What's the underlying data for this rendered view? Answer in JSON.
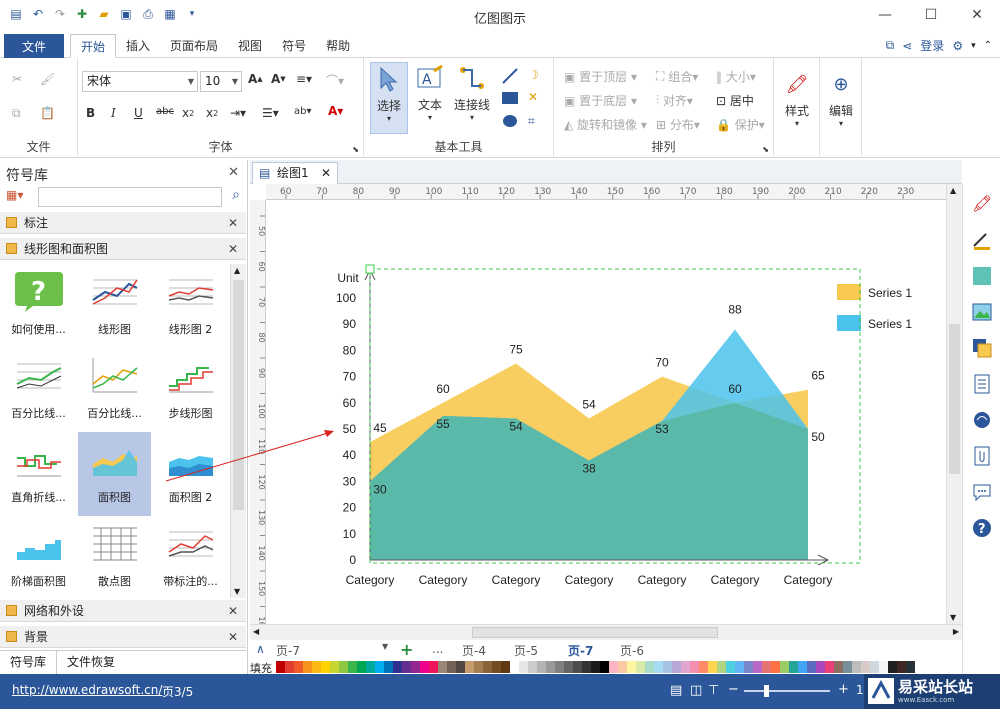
{
  "window": {
    "title": "亿图图示"
  },
  "menu": {
    "file": "文件",
    "tabs": [
      "开始",
      "插入",
      "页面布局",
      "视图",
      "符号",
      "帮助"
    ],
    "active_tab": "开始",
    "login": "登录"
  },
  "ribbon": {
    "font_name": "宋体",
    "font_size": "10",
    "groups": {
      "file": "文件",
      "font": "字体",
      "basic_tools": "基本工具",
      "arrange": "排列"
    },
    "tools": {
      "select": "选择",
      "text": "文本",
      "connector": "连接线",
      "style": "样式",
      "edit": "编辑"
    },
    "arrange": {
      "bring_front": "置于顶层",
      "send_back": "置于底层",
      "rotate_mirror": "旋转和镜像",
      "group": "组合",
      "align": "对齐",
      "distribute": "分布",
      "size": "大小",
      "center": "居中",
      "protect": "保护"
    }
  },
  "library": {
    "title": "符号库",
    "categories": {
      "annotation": "标注",
      "line_area": "线形图和面积图",
      "grid_outer": "网络和外设",
      "background": "背景"
    },
    "shapes": [
      {
        "label": "如何使用...",
        "kind": "help"
      },
      {
        "label": "线形图",
        "kind": "line"
      },
      {
        "label": "线形图 2",
        "kind": "line2"
      },
      {
        "label": "百分比线...",
        "kind": "pctline"
      },
      {
        "label": "百分比线...",
        "kind": "pctline2"
      },
      {
        "label": "步线形图",
        "kind": "step"
      },
      {
        "label": "直角折线...",
        "kind": "rightangle"
      },
      {
        "label": "面积图",
        "kind": "area",
        "selected": true
      },
      {
        "label": "面积图 2",
        "kind": "area2"
      },
      {
        "label": "阶梯面积图",
        "kind": "steparea"
      },
      {
        "label": "散点图",
        "kind": "scatter"
      },
      {
        "label": "带标注的...",
        "kind": "annotated"
      }
    ],
    "bottom_tabs": [
      "符号库",
      "文件恢复"
    ]
  },
  "document": {
    "tab": "绘图1",
    "hruler": [
      "60",
      "70",
      "80",
      "90",
      "100",
      "110",
      "120",
      "130",
      "140",
      "150",
      "160",
      "170",
      "180",
      "190",
      "200",
      "210",
      "220",
      "230"
    ],
    "vruler": [
      "50",
      "60",
      "70",
      "80",
      "90",
      "100",
      "110",
      "120",
      "130",
      "140",
      "150",
      "160"
    ],
    "pages": [
      "页-7",
      "...",
      "页-4",
      "页-5",
      "页-7",
      "页-6"
    ],
    "active_page": "页-7",
    "fill_label": "填充"
  },
  "chart_data": {
    "type": "area",
    "categories": [
      "Category",
      "Category",
      "Category",
      "Category",
      "Category",
      "Category",
      "Category"
    ],
    "series": [
      {
        "name": "Series 1",
        "values": [
          45,
          60,
          75,
          54,
          70,
          60,
          65
        ],
        "color": "#f7c94f"
      },
      {
        "name": "Series 1",
        "values": [
          30,
          55,
          54,
          38,
          53,
          88,
          50
        ],
        "color": "#4bc3ec"
      }
    ],
    "ylabel": "Unit",
    "ylim": [
      0,
      100
    ],
    "yticks": [
      "0",
      "10",
      "20",
      "30",
      "40",
      "50",
      "60",
      "70",
      "80",
      "90",
      "100"
    ],
    "legend_position": "right",
    "grid": false
  },
  "status": {
    "url": "http://www.edrawsoft.cn/",
    "page": "页3/5",
    "zoom": "10",
    "watermark": "易采站长站",
    "watermark_sub": "www.Easck.com"
  },
  "colors": {
    "accent": "#2b579a",
    "palette": [
      "#c00000",
      "#e03c31",
      "#f05a28",
      "#f7941d",
      "#fdb913",
      "#ffd200",
      "#c7d530",
      "#8dc63f",
      "#39b54a",
      "#00a651",
      "#00a99d",
      "#00aeef",
      "#0072bc",
      "#2e3192",
      "#662d91",
      "#92278f",
      "#ec008c",
      "#ed145b",
      "#998675",
      "#736357",
      "#534741",
      "#c69c6d",
      "#a67c52",
      "#8c6239",
      "#754c24",
      "#603913",
      "#ffffff",
      "#e6e6e6",
      "#cccccc",
      "#b3b3b3",
      "#999999",
      "#808080",
      "#666666",
      "#4d4d4d",
      "#333333",
      "#1a1a1a",
      "#000000",
      "#fbb4c4",
      "#f9c9a3",
      "#fff5a1",
      "#d7eaa7",
      "#a8dcc9",
      "#a6dbf1",
      "#a6c3e6",
      "#b7a6d6",
      "#e0a6cf",
      "#f48fb1",
      "#ff8a65",
      "#ffd54f",
      "#aed581",
      "#4dd0e1",
      "#64b5f6",
      "#7986cb",
      "#ba68c8",
      "#e57373",
      "#ff7043",
      "#9ccc65",
      "#26a69a",
      "#42a5f5",
      "#5c6bc0",
      "#ab47bc",
      "#ec407a",
      "#8d6e63",
      "#78909c",
      "#bdbdbd",
      "#d7ccc8",
      "#cfd8dc",
      "#f5f5f5",
      "#212121",
      "#3e2723",
      "#263238"
    ]
  }
}
